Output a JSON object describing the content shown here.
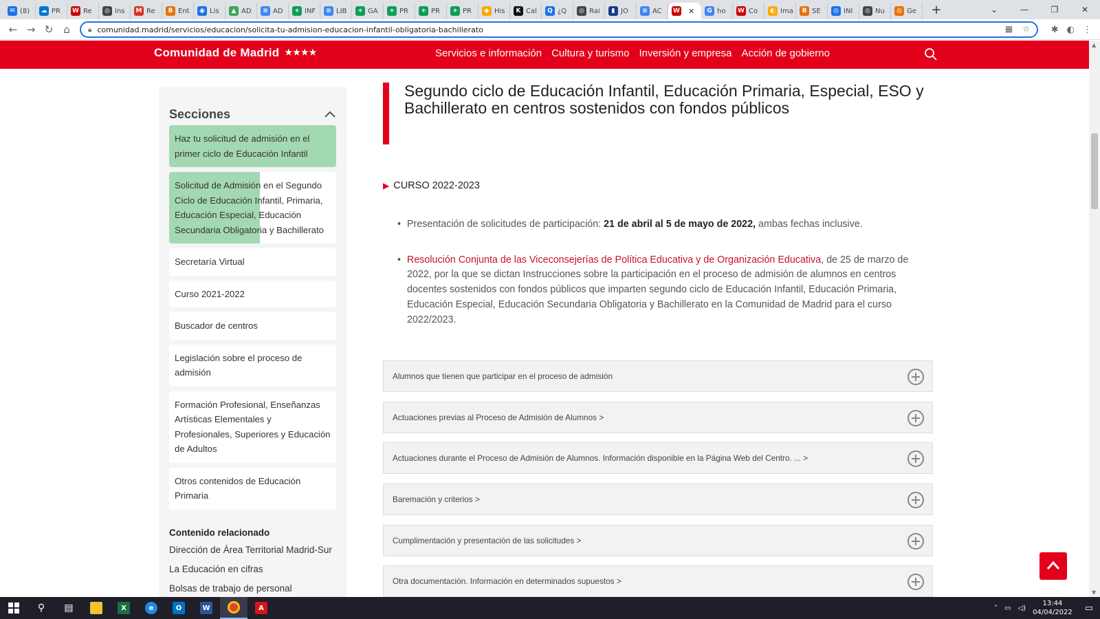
{
  "browser": {
    "tabs": [
      {
        "label": "(8)",
        "color": "#1a73e8",
        "glyph": "✉"
      },
      {
        "label": "PR",
        "color": "#0078d4",
        "glyph": "☁"
      },
      {
        "label": "Re",
        "color": "#c00",
        "glyph": "W"
      },
      {
        "label": "Ins",
        "color": "#444",
        "glyph": "◎"
      },
      {
        "label": "Re",
        "color": "#d93025",
        "glyph": "M"
      },
      {
        "label": "Ent",
        "color": "#e8710a",
        "glyph": "B"
      },
      {
        "label": "Lis",
        "color": "#1a73e8",
        "glyph": "◉"
      },
      {
        "label": "AD",
        "color": "#34a853",
        "glyph": "▲"
      },
      {
        "label": "AD",
        "color": "#4285f4",
        "glyph": "≡"
      },
      {
        "label": "INF",
        "color": "#0f9d58",
        "glyph": "+"
      },
      {
        "label": "LIB",
        "color": "#4285f4",
        "glyph": "≡"
      },
      {
        "label": "GA",
        "color": "#0f9d58",
        "glyph": "+"
      },
      {
        "label": "PR",
        "color": "#0f9d58",
        "glyph": "+"
      },
      {
        "label": "PR",
        "color": "#0f9d58",
        "glyph": "+"
      },
      {
        "label": "PR",
        "color": "#0f9d58",
        "glyph": "+"
      },
      {
        "label": "His",
        "color": "#f9ab00",
        "glyph": "◆"
      },
      {
        "label": "Cal",
        "color": "#111",
        "glyph": "K"
      },
      {
        "label": "¿Q",
        "color": "#1a73e8",
        "glyph": "Q"
      },
      {
        "label": "Rai",
        "color": "#444",
        "glyph": "◎"
      },
      {
        "label": "JO",
        "color": "#1a3a8a",
        "glyph": "▮"
      },
      {
        "label": "AC",
        "color": "#4285f4",
        "glyph": "≡"
      },
      {
        "label": "",
        "color": "#c00",
        "glyph": "W",
        "active": true
      },
      {
        "label": "ho",
        "color": "#4285f4",
        "glyph": "G"
      },
      {
        "label": "Co",
        "color": "#c00",
        "glyph": "W"
      },
      {
        "label": "Ima",
        "color": "#f9ab00",
        "glyph": "◐"
      },
      {
        "label": "SE",
        "color": "#e8710a",
        "glyph": "B"
      },
      {
        "label": "INI",
        "color": "#1a73e8",
        "glyph": "◎"
      },
      {
        "label": "Nu",
        "color": "#444",
        "glyph": "◎"
      },
      {
        "label": "Ge",
        "color": "#e8710a",
        "glyph": "◎"
      }
    ],
    "url": "comunidad.madrid/servicios/educacion/solicita-tu-admision-educacion-infantil-obligatoria-bachillerato"
  },
  "site": {
    "logo": "Comunidad de Madrid",
    "logo_stars": "★★★★",
    "nav": [
      "Servicios e información",
      "Cultura y turismo",
      "Inversión y empresa",
      "Acción de gobierno"
    ]
  },
  "sidebar": {
    "title": "Secciones",
    "items": [
      {
        "label": "Haz tu solicitud de admisión en el primer ciclo de Educación Infantil",
        "state": "sel"
      },
      {
        "label": "Solicitud de Admisión en el Segundo Ciclo de Educación Infantil, Primaria, Educación Especial, Educación Secundaria Obligatoria y Bachillerato",
        "state": "half"
      },
      {
        "label": "Secretaría Virtual",
        "state": ""
      },
      {
        "label": "Curso 2021-2022",
        "state": ""
      },
      {
        "label": "Buscador de centros",
        "state": ""
      },
      {
        "label": "Legislación sobre el proceso de admisión",
        "state": ""
      },
      {
        "label": "Formación Profesional, Enseñanzas Artísticas Elementales y Profesionales, Superiores y Educación de Adultos",
        "state": ""
      },
      {
        "label": "Otros contenidos de Educación Primaria",
        "state": ""
      }
    ],
    "related_title": "Contenido relacionado",
    "related": [
      "Dirección de Área Territorial Madrid-Sur",
      "La Educación en cifras",
      "Bolsas de trabajo de personal"
    ]
  },
  "main": {
    "title": "Segundo ciclo de Educación Infantil, Educación Primaria, Especial, ESO y Bachillerato en centros sostenidos con fondos públicos",
    "curso": "CURSO 2022-2023",
    "bullet1_pre": "Presentación de solicitudes de participación: ",
    "bullet1_bold": "21 de abril al 5 de mayo de 2022,",
    "bullet1_post": " ambas fechas inclusive.",
    "bullet2_link": "Resolución Conjunta de las Viceconsejerías de Política Educativa y de Organización Educativa",
    "bullet2_text": ", de 25 de marzo de 2022, por la que se dictan Instrucciones sobre la participación en el proceso de admisión de alumnos en centros docentes sostenidos con fondos públicos que imparten segundo ciclo de Educación Infantil, Educación Primaria, Educación Especial, Educación Secundaria Obligatoria y Bachillerato en la Comunidad de Madrid para el curso 2022/2023.",
    "accordions": [
      "Alumnos que tienen que participar en el proceso de admisión",
      "Actuaciones previas al Proceso de Admisión de Alumnos >",
      "Actuaciones durante el Proceso de Admisión de Alumnos. Información disponible en la Página Web del Centro. ... >",
      "Baremación y criterios >",
      "Cumplimentación y presentación de las solicitudes >",
      "Otra documentación. Información en determinados supuestos >"
    ]
  },
  "taskbar": {
    "time": "13:44",
    "date": "04/04/2022"
  },
  "colors": {
    "brand": "#e3001b",
    "selected": "#a3d9b1"
  }
}
